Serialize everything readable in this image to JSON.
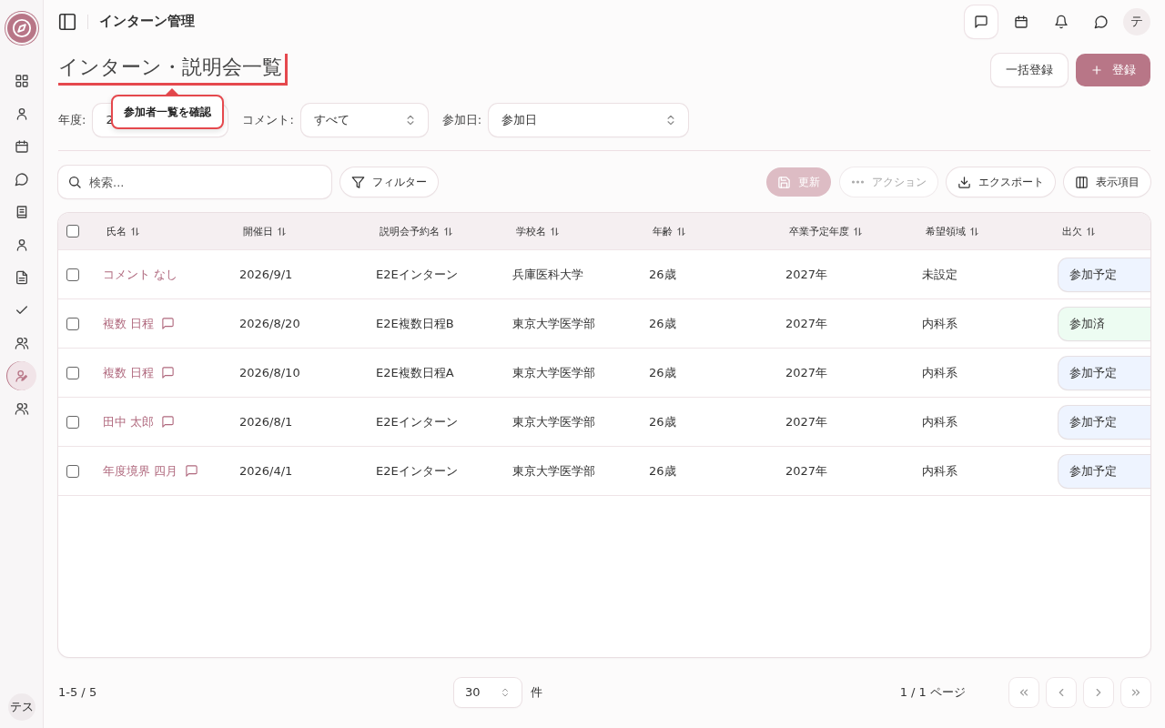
{
  "sidebar": {
    "items": [
      {
        "selected": false
      },
      {
        "selected": false
      },
      {
        "selected": false
      },
      {
        "selected": false
      },
      {
        "selected": false
      },
      {
        "selected": false
      },
      {
        "selected": false
      },
      {
        "selected": false
      },
      {
        "selected": false
      },
      {
        "selected": true
      },
      {
        "selected": false
      }
    ],
    "user": "テス"
  },
  "header": {
    "title": "インターン管理",
    "avatar": "テ"
  },
  "page": {
    "title": "インターン・説明会一覧",
    "highlighted": true,
    "tooltip": "参加者一覧を確認",
    "buttons": [
      {
        "label": "一括登録",
        "kind": "outline"
      },
      {
        "label": "登録",
        "kind": "primary"
      }
    ]
  },
  "filters": [
    {
      "label": "年度:",
      "value": "2"
    },
    {
      "label": "コメント:",
      "value": "すべて"
    },
    {
      "label": "参加日:",
      "value": "参加日"
    }
  ],
  "toolbar": {
    "search": {
      "placeholder": "検索..."
    },
    "filter_button": "フィルター",
    "buttons": [
      {
        "label": "更新",
        "kind": "save",
        "disabled": true
      },
      {
        "label": "アクション",
        "kind": "more",
        "disabled": true
      },
      {
        "label": "エクスポート",
        "kind": "export",
        "disabled": false
      },
      {
        "label": "表示項目",
        "kind": "columns",
        "disabled": false
      }
    ]
  },
  "table": {
    "all_checked": false,
    "columns": [
      "氏名",
      "開催日",
      "説明会予約名",
      "学校名",
      "年齢",
      "卒業予定年度",
      "希望領域",
      "出欠"
    ],
    "rows": [
      {
        "checked": false,
        "has_comment": false,
        "cells": [
          "コメント なし",
          "2026/9/1",
          "E2Eインターン",
          "兵庫医科大学",
          "26歳",
          "2027年",
          "未設定"
        ],
        "status": {
          "label": "参加予定",
          "color": "#eef4ff"
        }
      },
      {
        "checked": false,
        "has_comment": true,
        "cells": [
          "複数 日程",
          "2026/8/20",
          "E2E複数日程B",
          "東京大学医学部",
          "26歳",
          "2027年",
          "内科系"
        ],
        "status": {
          "label": "参加済",
          "color": "#edfcf2"
        }
      },
      {
        "checked": false,
        "has_comment": true,
        "cells": [
          "複数 日程",
          "2026/8/10",
          "E2E複数日程A",
          "東京大学医学部",
          "26歳",
          "2027年",
          "内科系"
        ],
        "status": {
          "label": "参加予定",
          "color": "#eef4ff"
        }
      },
      {
        "checked": false,
        "has_comment": true,
        "cells": [
          "田中 太郎",
          "2026/8/1",
          "E2Eインターン",
          "東京大学医学部",
          "26歳",
          "2027年",
          "内科系"
        ],
        "status": {
          "label": "参加予定",
          "color": "#eef4ff"
        }
      },
      {
        "checked": false,
        "has_comment": true,
        "cells": [
          "年度境界 四月",
          "2026/4/1",
          "E2Eインターン",
          "東京大学医学部",
          "26歳",
          "2027年",
          "内科系"
        ],
        "status": {
          "label": "参加予定",
          "color": "#eef4ff"
        }
      }
    ]
  },
  "footer": {
    "range": "1-5 / 5",
    "page_size": "30",
    "unit": "件",
    "page_info": "1 / 1 ページ"
  }
}
